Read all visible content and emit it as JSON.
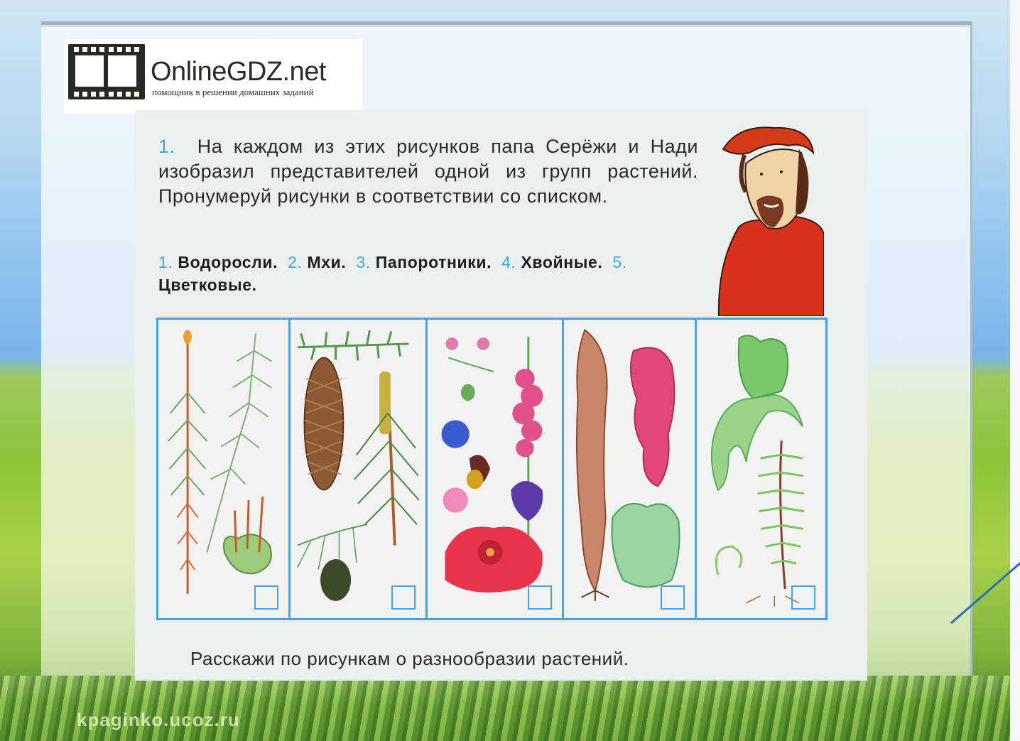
{
  "logo": {
    "title": "OnlineGDZ.net",
    "subtitle": "помощник в решении домашних заданий",
    "icon": "film-book-icon"
  },
  "task": {
    "number": "1.",
    "text": "На каждом из этих рисунков папа Серёжи и Нади изобразил представителей одной из групп растений. Пронумеруй рисунки в соответствии со списком."
  },
  "groups": [
    {
      "number": "1.",
      "label": "Водоросли."
    },
    {
      "number": "2.",
      "label": "Мхи."
    },
    {
      "number": "3.",
      "label": "Папоротники."
    },
    {
      "number": "4.",
      "label": "Хвойные."
    },
    {
      "number": "5.",
      "label": "Цветковые."
    }
  ],
  "panels": [
    {
      "depicts": "mosses",
      "answer": ""
    },
    {
      "depicts": "conifers",
      "answer": ""
    },
    {
      "depicts": "flowering-plants",
      "answer": ""
    },
    {
      "depicts": "algae",
      "answer": ""
    },
    {
      "depicts": "ferns",
      "answer": ""
    }
  ],
  "closing": "Расскажи по рисункам о разнообразии растений.",
  "watermark": "kpaginko.ucoz.ru",
  "colors": {
    "accent_blue": "#4aa3dc",
    "number_blue": "#3fa6e0",
    "shirt_red": "#d8321c",
    "hair_red": "#d23a1a"
  }
}
